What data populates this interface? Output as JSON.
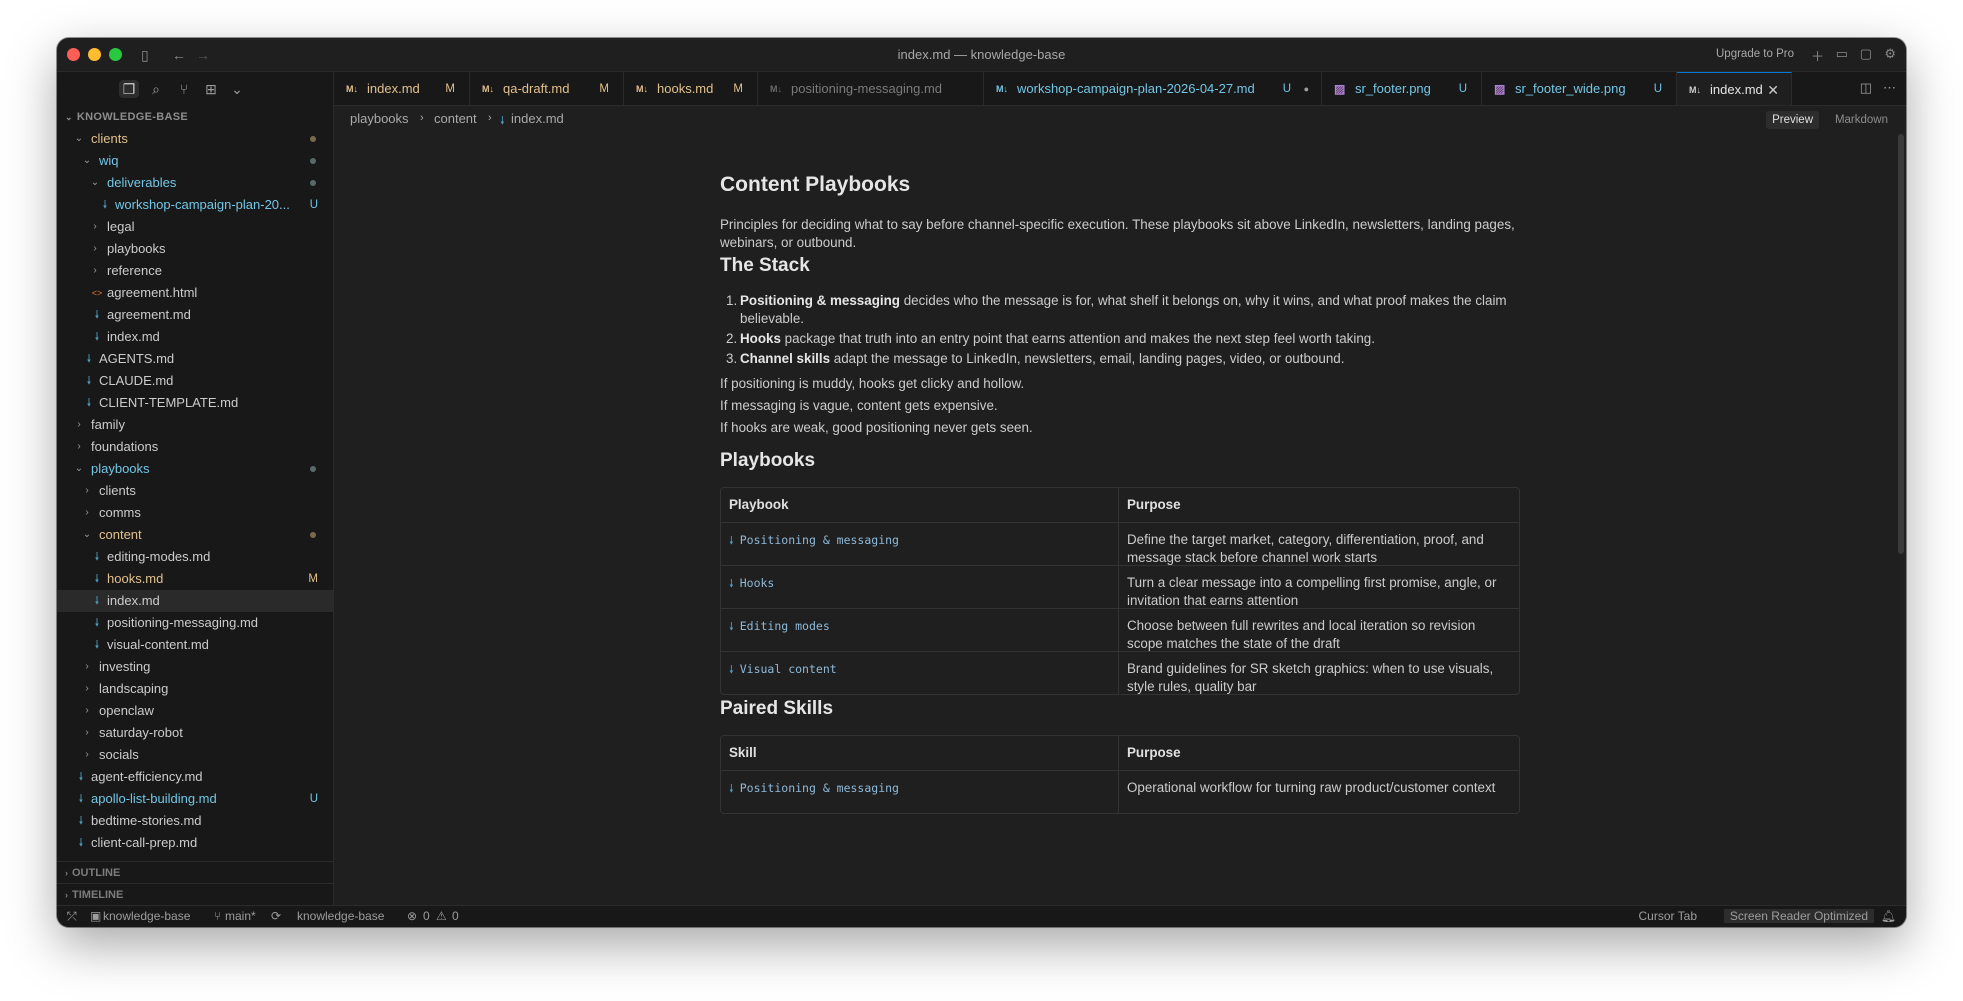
{
  "window": {
    "title": "index.md — knowledge-base",
    "upgrade": "Upgrade to Pro"
  },
  "sidebar": {
    "section": "KNOWLEDGE-BASE",
    "tree": [
      {
        "label": "clients",
        "indent": 1,
        "kind": "folder-open",
        "color": "c-orange",
        "badge": "dot"
      },
      {
        "label": "wiq",
        "indent": 2,
        "kind": "folder-open",
        "color": "c-cyan",
        "badge": "dot-grey"
      },
      {
        "label": "deliverables",
        "indent": 3,
        "kind": "folder-open",
        "color": "c-cyan",
        "badge": "dot-grey"
      },
      {
        "label": "workshop-campaign-plan-20...",
        "indent": 4,
        "kind": "md",
        "color": "c-cyan",
        "badge": "U"
      },
      {
        "label": "legal",
        "indent": 3,
        "kind": "folder",
        "color": "c-default",
        "badge": ""
      },
      {
        "label": "playbooks",
        "indent": 3,
        "kind": "folder",
        "color": "c-default",
        "badge": ""
      },
      {
        "label": "reference",
        "indent": 3,
        "kind": "folder",
        "color": "c-default",
        "badge": ""
      },
      {
        "label": "agreement.html",
        "indent": 3,
        "kind": "html",
        "color": "c-default",
        "badge": ""
      },
      {
        "label": "agreement.md",
        "indent": 3,
        "kind": "md",
        "color": "c-default",
        "badge": ""
      },
      {
        "label": "index.md",
        "indent": 3,
        "kind": "md",
        "color": "c-default",
        "badge": ""
      },
      {
        "label": "AGENTS.md",
        "indent": 2,
        "kind": "md",
        "color": "c-default",
        "badge": ""
      },
      {
        "label": "CLAUDE.md",
        "indent": 2,
        "kind": "md",
        "color": "c-default",
        "badge": ""
      },
      {
        "label": "CLIENT-TEMPLATE.md",
        "indent": 2,
        "kind": "md",
        "color": "c-default",
        "badge": ""
      },
      {
        "label": "family",
        "indent": 1,
        "kind": "folder",
        "color": "c-default",
        "badge": ""
      },
      {
        "label": "foundations",
        "indent": 1,
        "kind": "folder",
        "color": "c-default",
        "badge": ""
      },
      {
        "label": "playbooks",
        "indent": 1,
        "kind": "folder-open",
        "color": "c-cyan",
        "badge": "dot-grey"
      },
      {
        "label": "clients",
        "indent": 2,
        "kind": "folder",
        "color": "c-default",
        "badge": ""
      },
      {
        "label": "comms",
        "indent": 2,
        "kind": "folder",
        "color": "c-default",
        "badge": ""
      },
      {
        "label": "content",
        "indent": 2,
        "kind": "folder-open",
        "color": "c-orange",
        "badge": "dot"
      },
      {
        "label": "editing-modes.md",
        "indent": 3,
        "kind": "md",
        "color": "c-default",
        "badge": ""
      },
      {
        "label": "hooks.md",
        "indent": 3,
        "kind": "md",
        "color": "c-mod",
        "badge": "M"
      },
      {
        "label": "index.md",
        "indent": 3,
        "kind": "md",
        "color": "c-default",
        "badge": "",
        "selected": true
      },
      {
        "label": "positioning-messaging.md",
        "indent": 3,
        "kind": "md",
        "color": "c-default",
        "badge": ""
      },
      {
        "label": "visual-content.md",
        "indent": 3,
        "kind": "md",
        "color": "c-default",
        "badge": ""
      },
      {
        "label": "investing",
        "indent": 2,
        "kind": "folder",
        "color": "c-default",
        "badge": ""
      },
      {
        "label": "landscaping",
        "indent": 2,
        "kind": "folder",
        "color": "c-default",
        "badge": ""
      },
      {
        "label": "openclaw",
        "indent": 2,
        "kind": "folder",
        "color": "c-default",
        "badge": ""
      },
      {
        "label": "saturday-robot",
        "indent": 2,
        "kind": "folder",
        "color": "c-default",
        "badge": ""
      },
      {
        "label": "socials",
        "indent": 2,
        "kind": "folder",
        "color": "c-default",
        "badge": ""
      },
      {
        "label": "agent-efficiency.md",
        "indent": 1,
        "kind": "md",
        "color": "c-default",
        "badge": ""
      },
      {
        "label": "apollo-list-building.md",
        "indent": 1,
        "kind": "md",
        "color": "c-cyan",
        "badge": "U"
      },
      {
        "label": "bedtime-stories.md",
        "indent": 1,
        "kind": "md",
        "color": "c-default",
        "badge": ""
      },
      {
        "label": "client-call-prep.md",
        "indent": 1,
        "kind": "md",
        "color": "c-default",
        "badge": ""
      }
    ],
    "outline": "OUTLINE",
    "timeline": "TIMELINE"
  },
  "tabs": [
    {
      "name": "index.md",
      "flag": "M",
      "color": "c-mod"
    },
    {
      "name": "qa-draft.md",
      "flag": "M",
      "color": "c-mod"
    },
    {
      "name": "hooks.md",
      "flag": "M",
      "color": "c-mod"
    },
    {
      "name": "positioning-messaging.md",
      "flag": "",
      "color": "dim"
    },
    {
      "name": "workshop-campaign-plan-2026-04-27.md",
      "flag": "U",
      "color": "c-cyan",
      "dot": true
    },
    {
      "name": "sr_footer.png",
      "flag": "U",
      "color": "c-cyan"
    },
    {
      "name": "sr_footer_wide.png",
      "flag": "U",
      "color": "c-cyan"
    },
    {
      "name": "index.md",
      "flag": "",
      "color": "active"
    }
  ],
  "breadcrumb": [
    "playbooks",
    "content",
    "index.md"
  ],
  "modes": {
    "preview": "Preview",
    "markdown": "Markdown"
  },
  "doc": {
    "h1": "Content Playbooks",
    "intro": "Principles for deciding what to say before channel-specific execution. These playbooks sit above LinkedIn, newsletters, landing pages, webinars, or outbound.",
    "stack_title": "The Stack",
    "stack": [
      {
        "num": "1.",
        "bold": "Positioning & messaging",
        "text": " decides who the message is for, what shelf it belongs on, why it wins, and what proof makes the claim believable."
      },
      {
        "num": "2.",
        "bold": "Hooks",
        "text": " package that truth into an entry point that earns attention and makes the next step feel worth taking."
      },
      {
        "num": "3.",
        "bold": "Channel skills",
        "text": " adapt the message to LinkedIn, newsletters, email, landing pages, video, or outbound."
      }
    ],
    "p1": "If positioning is muddy, hooks get clicky and hollow.",
    "p2": "If messaging is vague, content gets expensive.",
    "p3": "If hooks are weak, good positioning never gets seen.",
    "playbooks_title": "Playbooks",
    "playbooks_head": [
      "Playbook",
      "Purpose"
    ],
    "playbooks_rows": [
      {
        "name": "Positioning & messaging",
        "purpose": "Define the target market, category, differentiation, proof, and message stack before channel work starts"
      },
      {
        "name": "Hooks",
        "purpose": "Turn a clear message into a compelling first promise, angle, or invitation that earns attention"
      },
      {
        "name": "Editing modes",
        "purpose": "Choose between full rewrites and local iteration so revision scope matches the state of the draft"
      },
      {
        "name": "Visual content",
        "purpose": "Brand guidelines for SR sketch graphics: when to use visuals, style rules, quality bar"
      }
    ],
    "paired_title": "Paired Skills",
    "paired_head": [
      "Skill",
      "Purpose"
    ],
    "paired_rows": [
      {
        "name": "Positioning & messaging",
        "purpose": "Operational workflow for turning raw product/customer context"
      }
    ]
  },
  "status": {
    "repo": "knowledge-base",
    "branch": "main*",
    "workspace": "knowledge-base",
    "errors": "0",
    "warnings": "0",
    "cursor_tab": "Cursor Tab",
    "screen_reader": "Screen Reader Optimized"
  }
}
